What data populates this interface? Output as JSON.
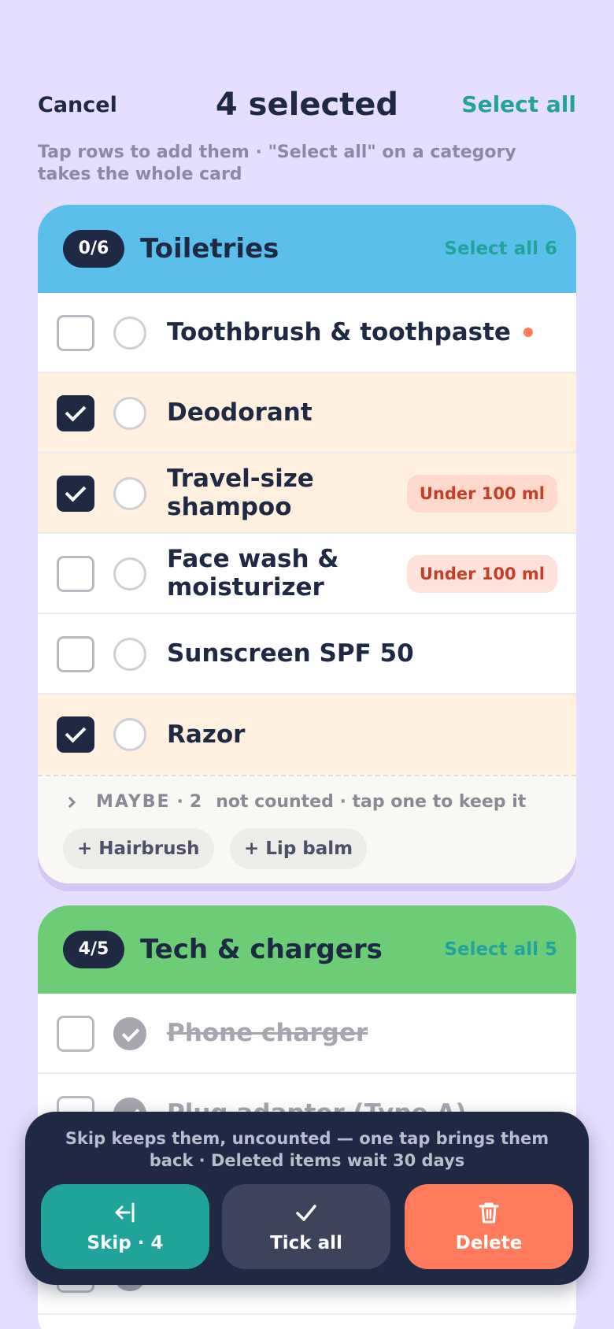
{
  "header": {
    "cancel": "Cancel",
    "title": "4 selected",
    "select_all": "Select all",
    "hint": "Tap rows to add them · \"Select all\" on a category takes the whole card"
  },
  "categories": [
    {
      "count": "0/6",
      "title": "Toiletries",
      "select_all": "Select all 6",
      "color": "#5bbfec",
      "items": [
        {
          "label": "Toothbrush & toothpaste",
          "selected": false,
          "done": false,
          "dot": true
        },
        {
          "label": "Deodorant",
          "selected": true,
          "done": false
        },
        {
          "label": "Travel-size shampoo",
          "selected": true,
          "done": false,
          "badge": "Under 100 ml"
        },
        {
          "label": "Face wash & moisturizer",
          "selected": false,
          "done": false,
          "badge": "Under 100 ml"
        },
        {
          "label": "Sunscreen SPF 50",
          "selected": false,
          "done": false
        },
        {
          "label": "Razor",
          "selected": true,
          "done": false
        }
      ],
      "maybe": {
        "tag": "MAYBE",
        "count": "2",
        "note": "not counted · tap one to keep it",
        "pills": [
          "+ Hairbrush",
          "+ Lip balm"
        ]
      }
    },
    {
      "count": "4/5",
      "title": "Tech & chargers",
      "select_all": "Select all 5",
      "color": "#6dcd77",
      "items": [
        {
          "label": "Phone charger",
          "selected": false,
          "done": true
        },
        {
          "label": "Plug adapter (Type A)",
          "selected": false,
          "done": true
        },
        {
          "label": "",
          "selected": false,
          "done": true
        },
        {
          "label": "",
          "selected": false,
          "done": true
        }
      ]
    }
  ],
  "action_bar": {
    "note": "Skip keeps them, uncounted — one tap brings them back · Deleted items wait 30 days",
    "skip": "Skip · 4",
    "tick_all": "Tick all",
    "delete": "Delete"
  },
  "colors": {
    "background": "#e6defe",
    "navy": "#1f2944",
    "teal": "#1fa39a",
    "coral": "#ff7b5c",
    "selected_row": "#fff0df"
  }
}
